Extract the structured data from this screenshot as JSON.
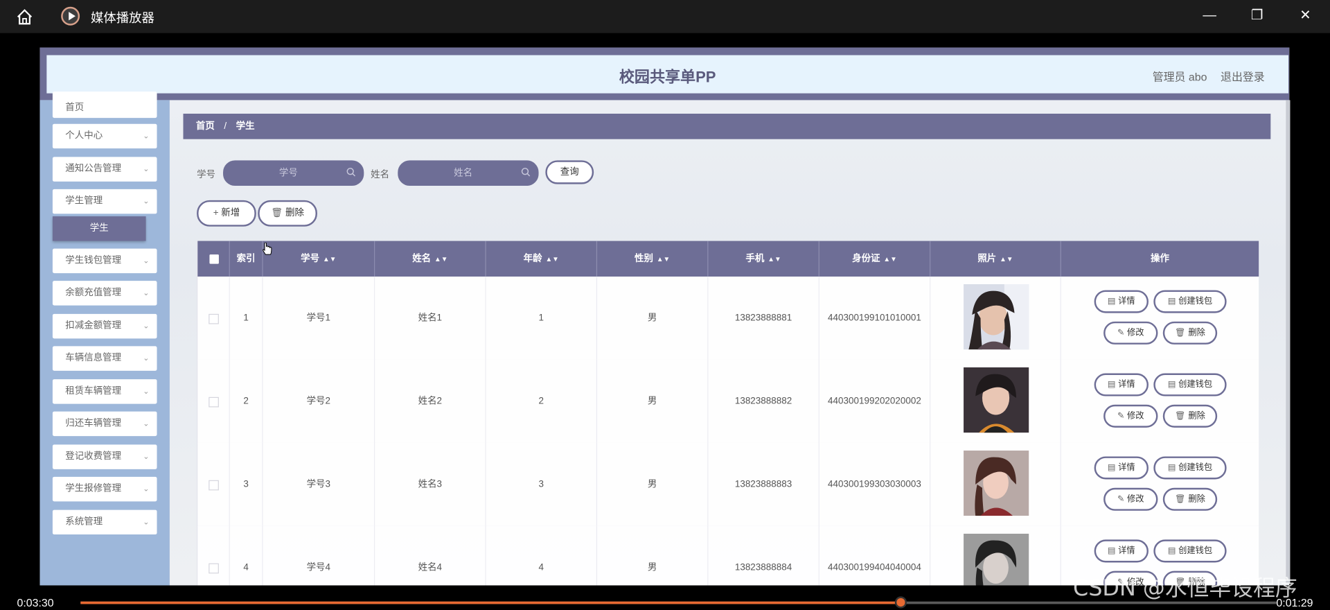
{
  "window": {
    "title": "媒体播放器",
    "home_icon": "home-icon",
    "app_icon": "media-player-icon",
    "controls": [
      "minimize-icon",
      "restore-icon",
      "close-icon"
    ]
  },
  "app": {
    "title": "校园共享单PP",
    "admin_label": "管理员 abo",
    "logout_label": "退出登录"
  },
  "sidebar": {
    "items": [
      {
        "label": "首页"
      },
      {
        "label": "个人中心"
      },
      {
        "label": "通知公告管理"
      },
      {
        "label": "学生管理"
      },
      {
        "label": "学生钱包管理"
      },
      {
        "label": "余额充值管理"
      },
      {
        "label": "扣减金额管理"
      },
      {
        "label": "车辆信息管理"
      },
      {
        "label": "租赁车辆管理"
      },
      {
        "label": "归还车辆管理"
      },
      {
        "label": "登记收费管理"
      },
      {
        "label": "学生报修管理"
      },
      {
        "label": "系统管理"
      }
    ],
    "active_submenu": "学生"
  },
  "breadcrumb": {
    "home": "首页",
    "sep": "/",
    "current": "学生"
  },
  "search": {
    "student_no_label": "学号",
    "student_no_placeholder": "学号",
    "name_label": "姓名",
    "name_placeholder": "姓名",
    "query_button": "查询"
  },
  "toolbar": {
    "add_button": "新增",
    "delete_button": "删除"
  },
  "table": {
    "columns": [
      "索引",
      "学号",
      "姓名",
      "年龄",
      "性别",
      "手机",
      "身份证",
      "照片",
      "操作"
    ],
    "rows": [
      {
        "index": "1",
        "student_no": "学号1",
        "name": "姓名1",
        "age": "1",
        "gender": "男",
        "phone": "13823888881",
        "id_card": "440300199101010001"
      },
      {
        "index": "2",
        "student_no": "学号2",
        "name": "姓名2",
        "age": "2",
        "gender": "男",
        "phone": "13823888882",
        "id_card": "440300199202020002"
      },
      {
        "index": "3",
        "student_no": "学号3",
        "name": "姓名3",
        "age": "3",
        "gender": "男",
        "phone": "13823888883",
        "id_card": "440300199303030003"
      },
      {
        "index": "4",
        "student_no": "学号4",
        "name": "姓名4",
        "age": "4",
        "gender": "男",
        "phone": "13823888884",
        "id_card": "440300199404040004"
      }
    ],
    "row_actions": {
      "detail": "详情",
      "create_wallet": "创建钱包",
      "edit": "修改",
      "delete": "删除"
    }
  },
  "player": {
    "elapsed": "0:03:30",
    "remaining": "0:01:29",
    "progress": 0.686
  },
  "watermark": "CSDN @水恒毕设程序",
  "colors": {
    "accent": "#6e6e96",
    "seek": "#e86a32",
    "sidebar": "#9db7da"
  }
}
